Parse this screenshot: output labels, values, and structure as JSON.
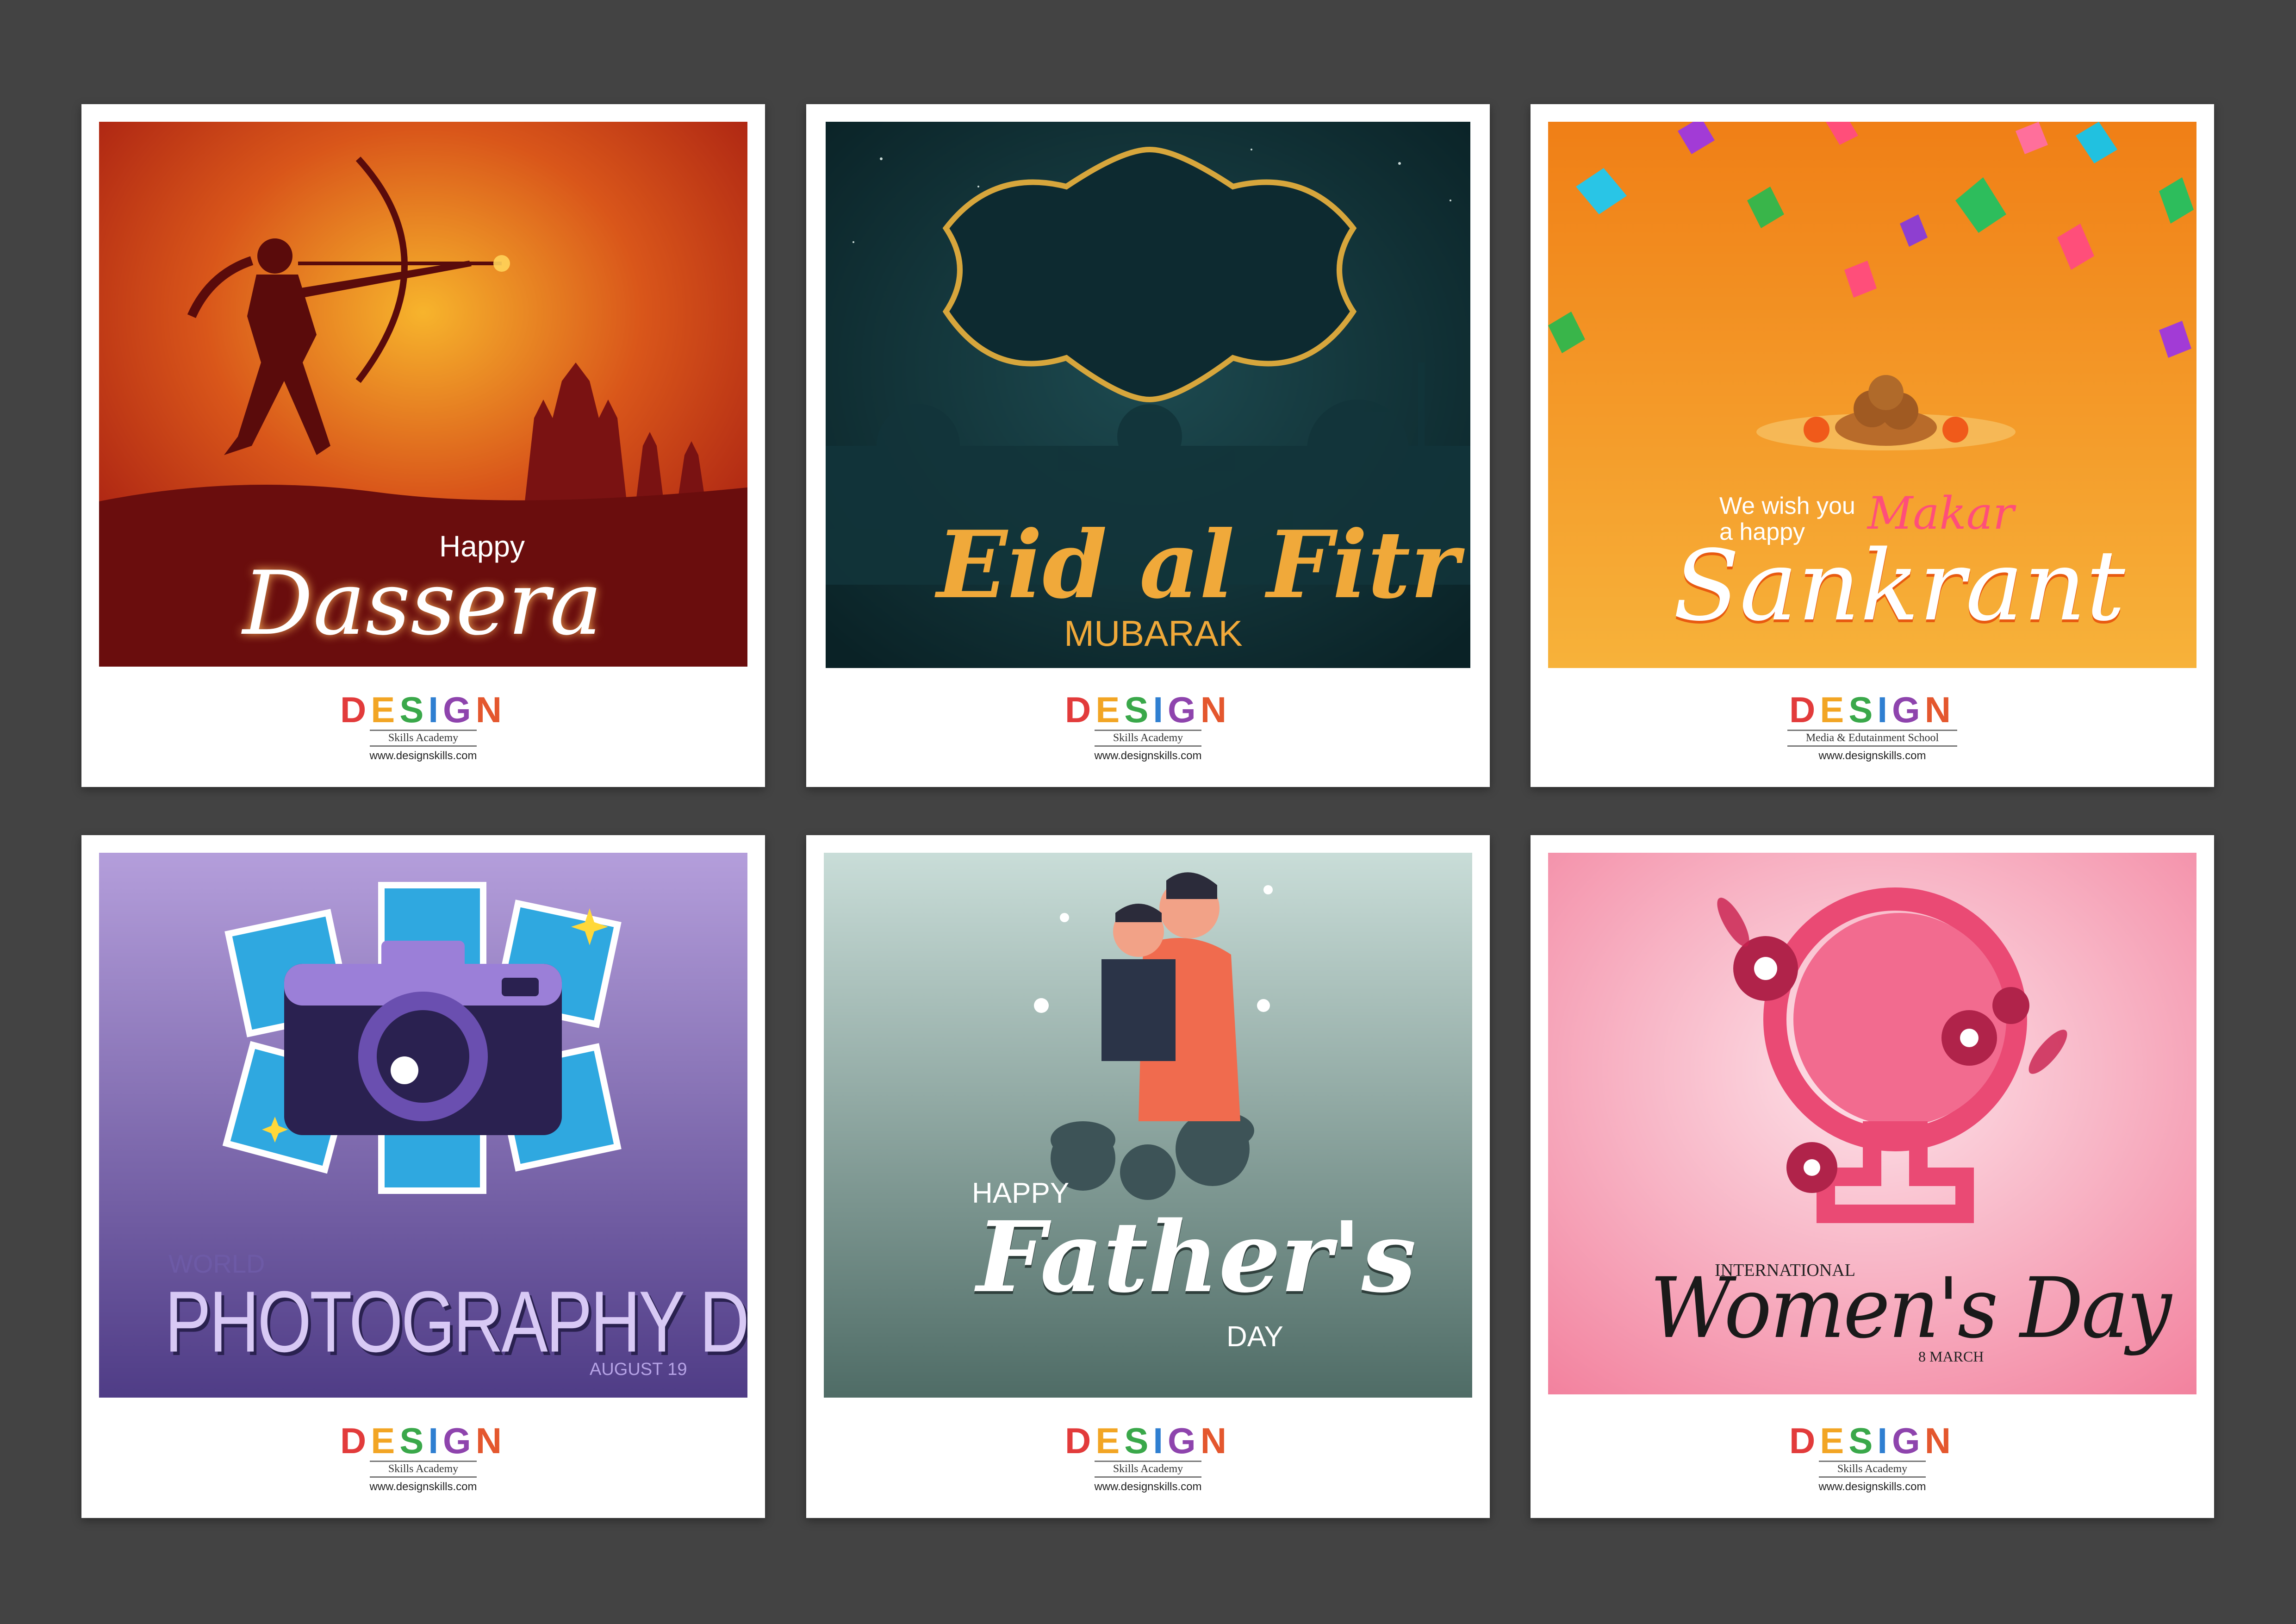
{
  "cards": [
    {
      "theme": "dassera",
      "lines": [
        "Happy",
        "Dassera"
      ],
      "logo": {
        "word": [
          "D",
          "E",
          "S",
          "I",
          "G",
          "N"
        ],
        "sub": "Skills Academy",
        "url": "www.designskills.com"
      }
    },
    {
      "theme": "eid",
      "lines": [
        "Eid al Fitr",
        "MUBARAK"
      ],
      "logo": {
        "word": [
          "D",
          "E",
          "S",
          "I",
          "G",
          "N"
        ],
        "sub": "Skills Academy",
        "url": "www.designskills.com"
      }
    },
    {
      "theme": "sankrant",
      "lines": [
        "We wish you",
        "a happy",
        "Makar",
        "Sankrant"
      ],
      "logo": {
        "word": [
          "D",
          "E",
          "S",
          "I",
          "G",
          "N"
        ],
        "sub": "Media & Edutainment School",
        "url": "www.designskills.com"
      }
    },
    {
      "theme": "photography",
      "lines": [
        "WORLD",
        "PHOTOGRAPHY DAY",
        "AUGUST 19"
      ],
      "logo": {
        "word": [
          "D",
          "E",
          "S",
          "I",
          "G",
          "N"
        ],
        "sub": "Skills Academy",
        "url": "www.designskills.com"
      }
    },
    {
      "theme": "fathers",
      "lines": [
        "HAPPY",
        "Father's",
        "DAY"
      ],
      "logo": {
        "word": [
          "D",
          "E",
          "S",
          "I",
          "G",
          "N"
        ],
        "sub": "Skills Academy",
        "url": "www.designskills.com"
      }
    },
    {
      "theme": "womens",
      "lines": [
        "INTERNATIONAL",
        "Women's Day",
        "8 MARCH"
      ],
      "logo": {
        "word": [
          "D",
          "E",
          "S",
          "I",
          "G",
          "N"
        ],
        "sub": "Skills Academy",
        "url": "www.designskills.com"
      }
    }
  ],
  "colors": {
    "background": "#434343",
    "dassera": "#c13a14",
    "eid": "#0f2d33",
    "sankrant": "#f59a22",
    "photography": "#6f5aa8",
    "fathers": "#7c9e96",
    "womens": "#f6a7b8"
  }
}
